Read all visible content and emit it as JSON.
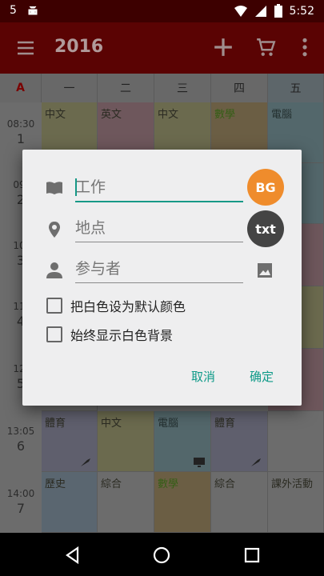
{
  "status": {
    "notif_count": "5",
    "time": "5:52"
  },
  "appbar": {
    "title": "2016"
  },
  "days": [
    "A",
    "一",
    "二",
    "三",
    "四",
    "五"
  ],
  "times": [
    {
      "t": "08:30",
      "n": "1"
    },
    {
      "t": "09:",
      "n": "2"
    },
    {
      "t": "10:",
      "n": "3"
    },
    {
      "t": "11:",
      "n": "4"
    },
    {
      "t": "12:",
      "n": "5"
    },
    {
      "t": "13:05",
      "n": "6"
    },
    {
      "t": "14:00",
      "n": "7"
    }
  ],
  "cells": {
    "r1": [
      "中文",
      "英文",
      "中文",
      "數學",
      "電腦"
    ],
    "r6": [
      "體育",
      "中文",
      "電腦",
      "體育",
      ""
    ],
    "r7": [
      "歷史",
      "綜合",
      "數學",
      "綜合",
      "課外活動"
    ]
  },
  "dialog": {
    "title_placeholder": "工作",
    "location_placeholder": "地点",
    "attendees_placeholder": "参与者",
    "bg_label": "BG",
    "txt_label": "txt",
    "check_default_white": "把白色设为默认颜色",
    "check_show_white": "始终显示白色背景",
    "cancel": "取消",
    "confirm": "确定"
  },
  "colors": {
    "accent": "#179987",
    "bg_circle": "#ef8c2c",
    "txt_circle": "#444444",
    "appbar": "#5a0303"
  }
}
